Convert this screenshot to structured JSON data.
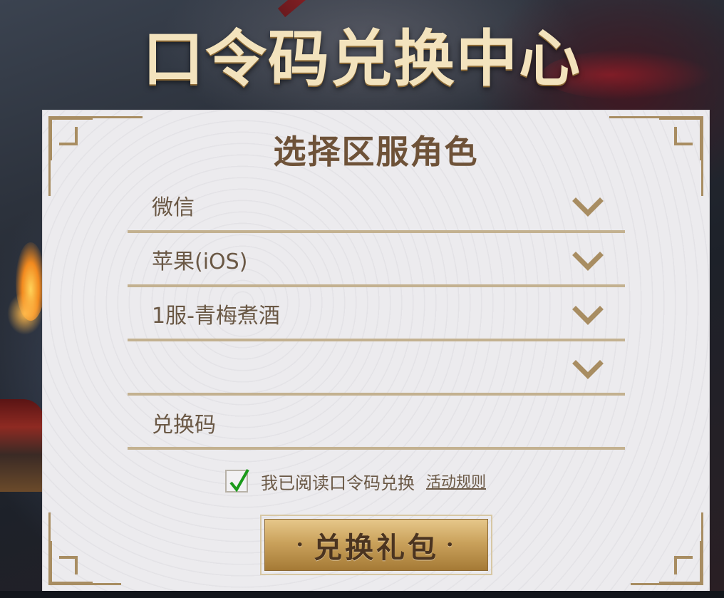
{
  "page": {
    "title": "口令码兑换中心"
  },
  "form": {
    "heading": "选择区服角色",
    "platform_value": "微信",
    "device_value": "苹果(iOS)",
    "server_value": "1服-青梅煮酒",
    "role_value": "",
    "code_placeholder": "兑换码",
    "agree_checked": true,
    "agree_text": "我已阅读口令码兑换",
    "rules_link": "活动规则",
    "submit_label": "兑换礼包",
    "submit_dot": "·"
  },
  "colors": {
    "accent_gold": "#a88d62",
    "text_brown": "#6a5845",
    "heading_brown": "#6e5238",
    "check_green": "#1a9a1a"
  },
  "icons": {
    "dropdown": "chevron-down-icon",
    "check": "checkmark-icon"
  }
}
